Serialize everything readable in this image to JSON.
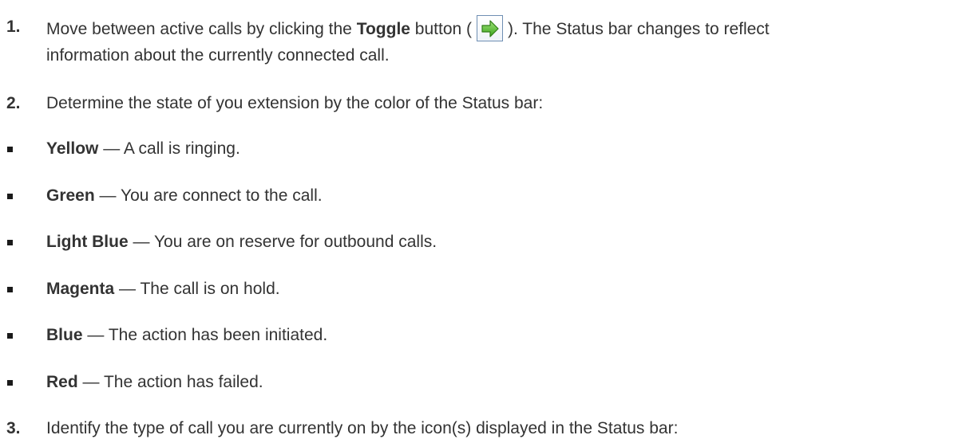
{
  "steps": [
    {
      "number": "1.",
      "parts": {
        "a": "Move between active calls by clicking the ",
        "b": "Toggle",
        "c": " button (",
        "d": "). The Status bar changes to reflect"
      },
      "line2": "information about the currently connected call."
    },
    {
      "number": "2.",
      "text": "Determine the state of you extension by the color of the Status bar:"
    },
    {
      "number": "3.",
      "text": "Identify the type of call you are currently on by the icon(s) displayed in the Status bar:"
    }
  ],
  "toggle_icon": "green-right-arrow-icon",
  "states": [
    {
      "color": "Yellow",
      "dash": " — ",
      "desc": "A call is ringing."
    },
    {
      "color": "Green",
      "dash": " — ",
      "desc": "You are connect to the call."
    },
    {
      "color": "Light Blue",
      "dash": " — ",
      "desc": "You are on reserve for outbound calls."
    },
    {
      "color": "Magenta",
      "dash": " — ",
      "desc": "The call is on hold."
    },
    {
      "color": "Blue",
      "dash": " — ",
      "desc": "The action has been initiated."
    },
    {
      "color": "Red",
      "dash": " — ",
      "desc": "The action has failed."
    }
  ]
}
